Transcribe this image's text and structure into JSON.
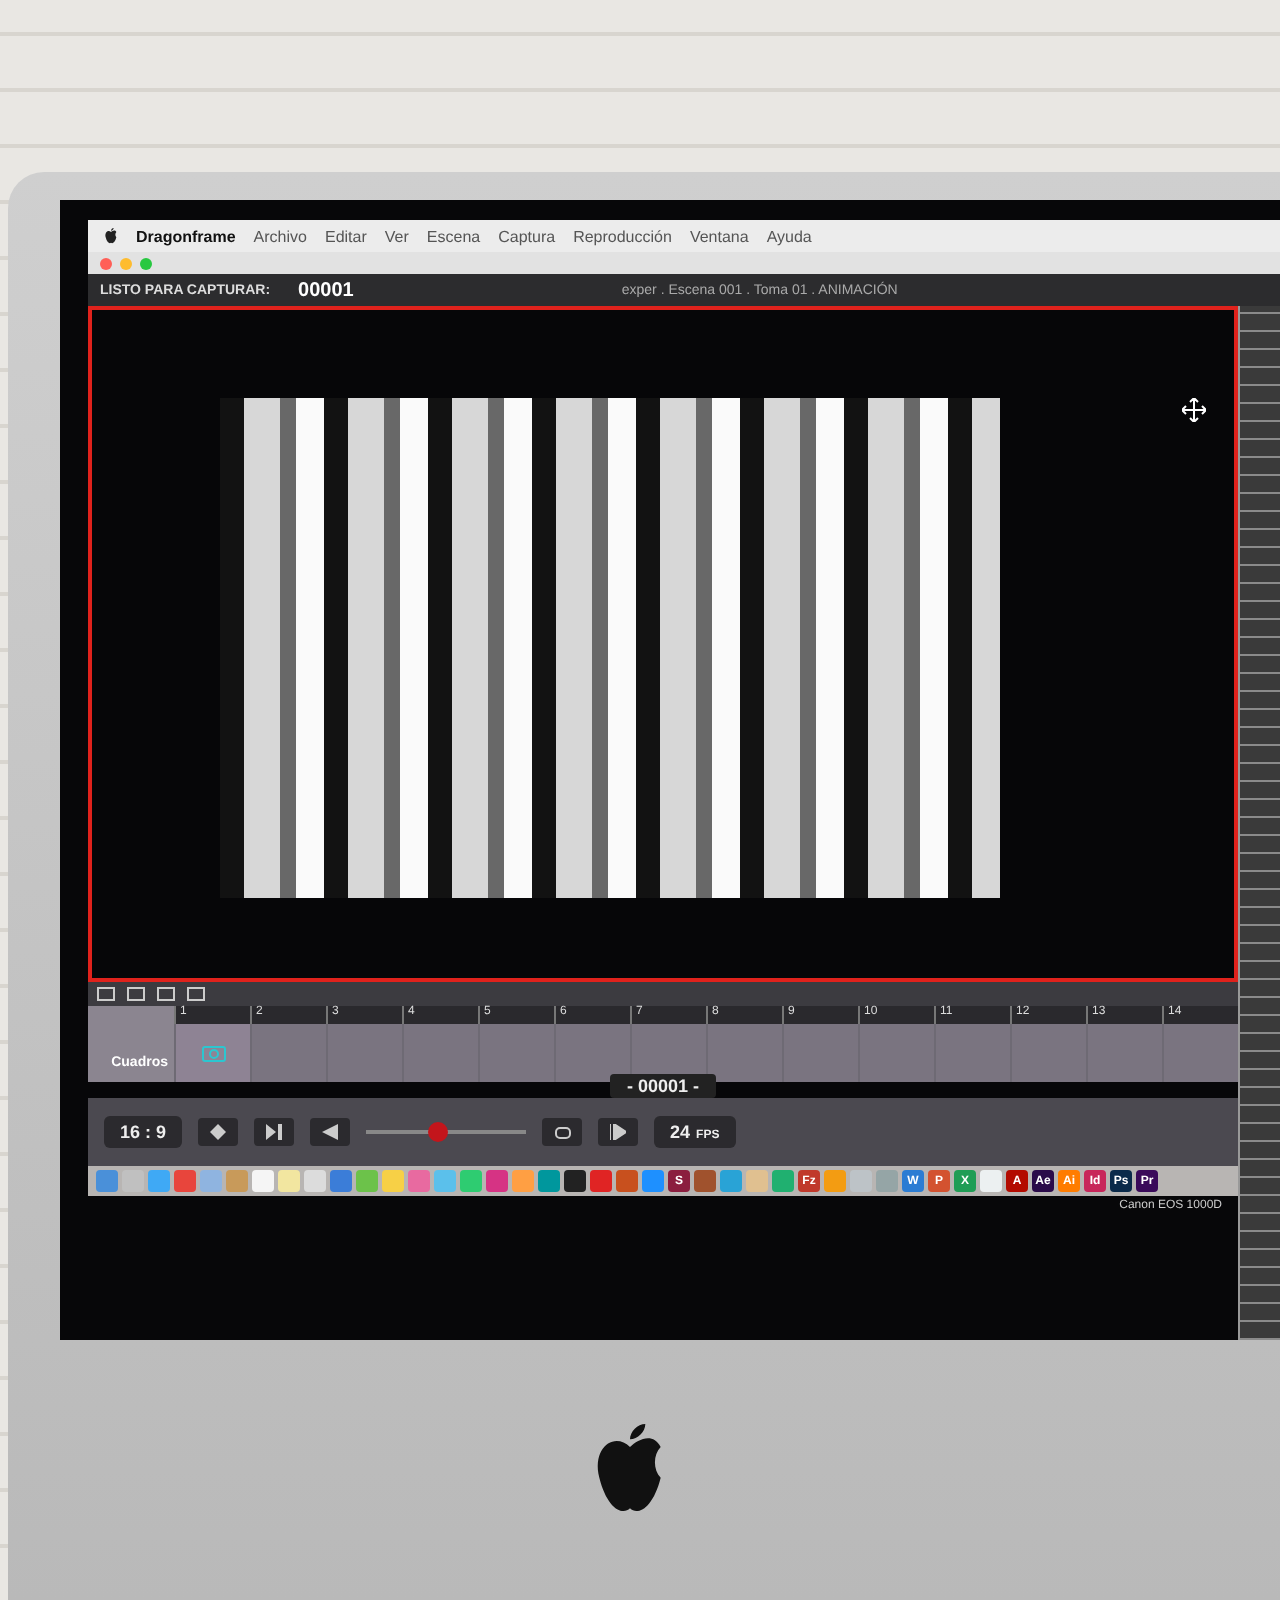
{
  "menu_bar": {
    "app_name": "Dragonframe",
    "items": [
      "Archivo",
      "Editar",
      "Ver",
      "Escena",
      "Captura",
      "Reproducción",
      "Ventana",
      "Ayuda"
    ]
  },
  "header": {
    "status_label": "LISTO PARA CAPTURAR:",
    "frame": "00001",
    "title": "exper . Escena 001 . Toma 01 . ANIMACIÓN"
  },
  "timeline": {
    "track_label": "Cuadros",
    "current_frame": "- 00001 -",
    "frame_marks": [
      "1",
      "2",
      "3",
      "4",
      "5",
      "6",
      "7",
      "8",
      "9",
      "10",
      "11",
      "12",
      "13",
      "14"
    ]
  },
  "controls": {
    "aspect": "16 : 9",
    "playback": {
      "level": 0.45
    },
    "fps_value": "24",
    "fps_unit": "FPS"
  },
  "camera": "Canon EOS 1000D",
  "dock": [
    {
      "kind": "plain",
      "color": "#4a90d9"
    },
    {
      "kind": "plain",
      "color": "#c0c0c0"
    },
    {
      "kind": "plain",
      "color": "#3fa9f5"
    },
    {
      "kind": "plain",
      "color": "#e8453c"
    },
    {
      "kind": "plain",
      "color": "#8fb4e0"
    },
    {
      "kind": "plain",
      "color": "#c89a5a"
    },
    {
      "kind": "plain",
      "color": "#f5f5f5"
    },
    {
      "kind": "plain",
      "color": "#f2e6a0"
    },
    {
      "kind": "plain",
      "color": "#dcdcdc"
    },
    {
      "kind": "plain",
      "color": "#3b7dd8"
    },
    {
      "kind": "plain",
      "color": "#6cc24a"
    },
    {
      "kind": "plain",
      "color": "#f7d046"
    },
    {
      "kind": "plain",
      "color": "#e86aa0"
    },
    {
      "kind": "plain",
      "color": "#5bc0eb"
    },
    {
      "kind": "plain",
      "color": "#2ecc71"
    },
    {
      "kind": "plain",
      "color": "#d63384"
    },
    {
      "kind": "plain",
      "color": "#ff9f43"
    },
    {
      "kind": "plain",
      "color": "#00979d"
    },
    {
      "kind": "plain",
      "color": "#222222"
    },
    {
      "kind": "plain",
      "color": "#e02424"
    },
    {
      "kind": "plain",
      "color": "#c8501e"
    },
    {
      "kind": "plain",
      "color": "#1e90ff"
    },
    {
      "kind": "letter",
      "label": "S",
      "color": "#8b1e3f"
    },
    {
      "kind": "plain",
      "color": "#a0522d"
    },
    {
      "kind": "plain",
      "color": "#29a3d6"
    },
    {
      "kind": "plain",
      "color": "#e0c090"
    },
    {
      "kind": "plain",
      "color": "#20b070"
    },
    {
      "kind": "letter",
      "label": "Fz",
      "color": "#c0392b"
    },
    {
      "kind": "plain",
      "color": "#f39c12"
    },
    {
      "kind": "plain",
      "color": "#bdc3c7"
    },
    {
      "kind": "plain",
      "color": "#95a5a6"
    },
    {
      "kind": "letter",
      "label": "W",
      "color": "#2b7cd3"
    },
    {
      "kind": "letter",
      "label": "P",
      "color": "#d35230"
    },
    {
      "kind": "letter",
      "label": "X",
      "color": "#1f9d55"
    },
    {
      "kind": "plain",
      "color": "#ecf0f1"
    },
    {
      "kind": "letter",
      "label": "A",
      "color": "#b30b00"
    },
    {
      "kind": "letter",
      "label": "Ae",
      "color": "#2a0a4a"
    },
    {
      "kind": "letter",
      "label": "Ai",
      "color": "#ff7c00"
    },
    {
      "kind": "letter",
      "label": "Id",
      "color": "#c8265a"
    },
    {
      "kind": "letter",
      "label": "Ps",
      "color": "#0a2a4a"
    },
    {
      "kind": "letter",
      "label": "Pr",
      "color": "#3a0a5a"
    }
  ]
}
